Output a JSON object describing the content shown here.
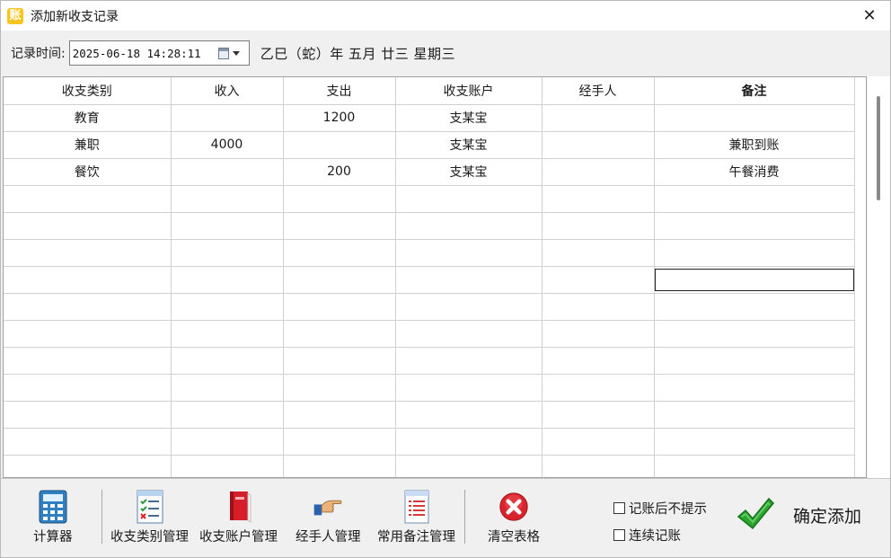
{
  "window": {
    "title": "添加新收支记录",
    "close_glyph": "✕",
    "app_icon_glyph": "账"
  },
  "time": {
    "label": "记录时间:",
    "value": "2025-06-18 14:28:11",
    "lunar": "乙巳（蛇）年 五月 廿三 星期三"
  },
  "grid": {
    "columns": [
      "收支类别",
      "收入",
      "支出",
      "收支账户",
      "经手人",
      "备注"
    ],
    "rows": [
      [
        "教育",
        "",
        "1200",
        "支某宝",
        "",
        ""
      ],
      [
        "兼职",
        "4000",
        "",
        "支某宝",
        "",
        "兼职到账"
      ],
      [
        "餐饮",
        "",
        "200",
        "支某宝",
        "",
        "午餐消费"
      ]
    ],
    "empty_rows": 11
  },
  "toolbar": {
    "calculator": "计算器",
    "category_mgmt": "收支类别管理",
    "account_mgmt": "收支账户管理",
    "handler_mgmt": "经手人管理",
    "note_mgmt": "常用备注管理",
    "clear_table": "清空表格",
    "no_prompt": "记账后不提示",
    "continuous": "连续记账",
    "confirm": "确定添加"
  }
}
